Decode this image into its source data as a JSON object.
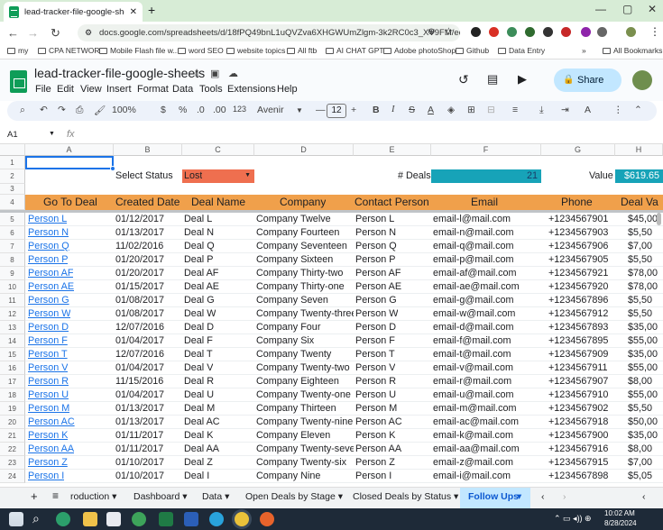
{
  "browser": {
    "tab_title": "lead-tracker-file-google-sheets",
    "url": "docs.google.com/spreadsheets/d/18fPQ49bnL1uQVZva6XHGWUmZlgm-3k2RC0c3_XV9FM/edit?g...",
    "bookmarks": [
      "my",
      "CPA NETWOR",
      "Mobile Flash file w...",
      "word SEO",
      "website topics",
      "All ftb",
      "AI CHAT GPT",
      "Adobe photoShop",
      "Github",
      "Data Entry"
    ],
    "all_bookmarks": "All Bookmarks"
  },
  "app": {
    "doc_title": "lead-tracker-file-google-sheets",
    "menus": [
      "File",
      "Edit",
      "View",
      "Insert",
      "Format",
      "Data",
      "Tools",
      "Extensions",
      "Help"
    ],
    "share_label": "Share"
  },
  "toolbar": {
    "zoom": "100%",
    "currency": "$",
    "percent": "%",
    "dec_decrease": ".0",
    "dec_increase": ".00",
    "number_format": "123",
    "font": "Avenir",
    "font_size": "12",
    "bold": "B",
    "italic": "I",
    "strike": "S",
    "text_color": "A"
  },
  "formula_bar": {
    "cell_ref": "A1",
    "fx": "fx",
    "value": ""
  },
  "sheet": {
    "columns": [
      "A",
      "B",
      "C",
      "D",
      "E",
      "F",
      "G",
      "H"
    ],
    "select_status_label": "Select Status",
    "select_status_value": "Lost",
    "deals_label": "# Deals",
    "deals_value": "21",
    "value_label": "Value",
    "value_value": "$619.65",
    "headers": [
      "Go To Deal",
      "Created Date",
      "Deal Name",
      "Company",
      "Contact Person",
      "Email",
      "Phone",
      "Deal Va"
    ],
    "rows": [
      [
        "Person L",
        "01/12/2017",
        "Deal L",
        "Company Twelve",
        "Person L",
        "email-l@mail.com",
        "+1234567901",
        "$45,00"
      ],
      [
        "Person N",
        "01/13/2017",
        "Deal N",
        "Company Fourteen",
        "Person N",
        "email-n@mail.com",
        "+1234567903",
        "$5,50"
      ],
      [
        "Person Q",
        "11/02/2016",
        "Deal Q",
        "Company Seventeen",
        "Person Q",
        "email-q@mail.com",
        "+1234567906",
        "$7,00"
      ],
      [
        "Person P",
        "01/20/2017",
        "Deal P",
        "Company Sixteen",
        "Person P",
        "email-p@mail.com",
        "+1234567905",
        "$5,50"
      ],
      [
        "Person AF",
        "01/20/2017",
        "Deal AF",
        "Company Thirty-two",
        "Person AF",
        "email-af@mail.com",
        "+1234567921",
        "$78,00"
      ],
      [
        "Person AE",
        "01/15/2017",
        "Deal AE",
        "Company Thirty-one",
        "Person AE",
        "email-ae@mail.com",
        "+1234567920",
        "$78,00"
      ],
      [
        "Person G",
        "01/08/2017",
        "Deal G",
        "Company Seven",
        "Person G",
        "email-g@mail.com",
        "+1234567896",
        "$5,50"
      ],
      [
        "Person W",
        "01/08/2017",
        "Deal W",
        "Company Twenty-three",
        "Person W",
        "email-w@mail.com",
        "+1234567912",
        "$5,50"
      ],
      [
        "Person D",
        "12/07/2016",
        "Deal D",
        "Company Four",
        "Person D",
        "email-d@mail.com",
        "+1234567893",
        "$35,00"
      ],
      [
        "Person F",
        "01/04/2017",
        "Deal F",
        "Company Six",
        "Person F",
        "email-f@mail.com",
        "+1234567895",
        "$55,00"
      ],
      [
        "Person T",
        "12/07/2016",
        "Deal T",
        "Company Twenty",
        "Person T",
        "email-t@mail.com",
        "+1234567909",
        "$35,00"
      ],
      [
        "Person V",
        "01/04/2017",
        "Deal V",
        "Company Twenty-two",
        "Person V",
        "email-v@mail.com",
        "+1234567911",
        "$55,00"
      ],
      [
        "Person R",
        "11/15/2016",
        "Deal R",
        "Company Eighteen",
        "Person R",
        "email-r@mail.com",
        "+1234567907",
        "$8,00"
      ],
      [
        "Person U",
        "01/04/2017",
        "Deal U",
        "Company Twenty-one",
        "Person U",
        "email-u@mail.com",
        "+1234567910",
        "$55,00"
      ],
      [
        "Person M",
        "01/13/2017",
        "Deal M",
        "Company Thirteen",
        "Person M",
        "email-m@mail.com",
        "+1234567902",
        "$5,50"
      ],
      [
        "Person AC",
        "01/13/2017",
        "Deal AC",
        "Company Twenty-nine",
        "Person AC",
        "email-ac@mail.com",
        "+1234567918",
        "$50,00"
      ],
      [
        "Person K",
        "01/11/2017",
        "Deal K",
        "Company Eleven",
        "Person K",
        "email-k@mail.com",
        "+1234567900",
        "$35,00"
      ],
      [
        "Person AA",
        "01/11/2017",
        "Deal AA",
        "Company Twenty-seven",
        "Person AA",
        "email-aa@mail.com",
        "+1234567916",
        "$8,00"
      ],
      [
        "Person Z",
        "01/10/2017",
        "Deal Z",
        "Company Twenty-six",
        "Person Z",
        "email-z@mail.com",
        "+1234567915",
        "$7,00"
      ],
      [
        "Person I",
        "01/10/2017",
        "Deal I",
        "Company Nine",
        "Person I",
        "email-i@mail.com",
        "+1234567898",
        "$5,05"
      ]
    ]
  },
  "sheet_tabs": [
    "roduction",
    "Dashboard",
    "Data",
    "Open Deals by Stage",
    "Closed Deals by Status",
    "Follow Ups"
  ],
  "active_sheet": "Follow Ups",
  "taskbar": {
    "time": "10:02 AM",
    "date": "8/28/2024"
  },
  "colors": {
    "header_row": "#f0a04b",
    "status_red": "#ef6f4f",
    "deals_teal": "#17a3b8",
    "link_blue": "#1a73e8",
    "tab_active": "#c2e7ff"
  }
}
